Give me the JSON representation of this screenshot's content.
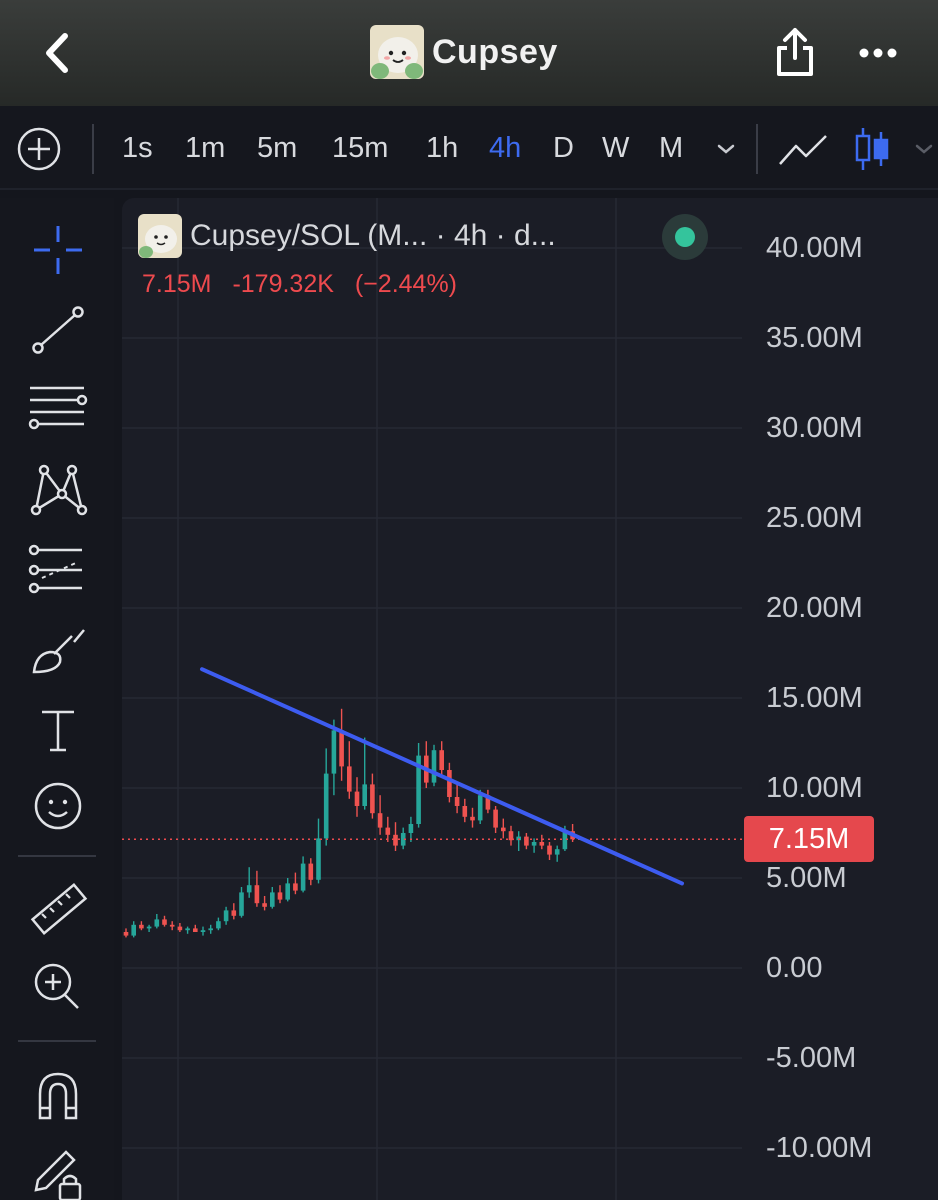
{
  "header": {
    "title": "Cupsey",
    "back_icon": "chevron-left-icon",
    "share_icon": "share-icon",
    "more_icon": "more-horizontal-icon"
  },
  "timeframes": {
    "items": [
      "1s",
      "1m",
      "5m",
      "15m",
      "1h",
      "4h",
      "D",
      "W",
      "M"
    ],
    "active": "4h"
  },
  "chart": {
    "legend_title": "Cupsey/SOL (M... · 4h · d...",
    "last_value": "7.15M",
    "change": "-179.32K",
    "change_pct": "(−2.44%)",
    "price_tag": "7.15M",
    "y_ticks": [
      "40.00M",
      "35.00M",
      "30.00M",
      "25.00M",
      "20.00M",
      "15.00M",
      "10.00M",
      "5.00M",
      "0.00",
      "-5.00M",
      "-10.00M"
    ],
    "up_color": "#26a69a",
    "down_color": "#ef5350",
    "trendline_color": "#3d5cf0"
  },
  "chart_data": {
    "type": "candlestick",
    "interval": "4h",
    "ylim": [
      -12000000,
      42000000
    ],
    "last": 7150000,
    "trendline": {
      "from": 16600000,
      "to": 4700000
    },
    "ohlc": [
      [
        2.0,
        2.2,
        1.7,
        1.8
      ],
      [
        1.8,
        2.6,
        1.7,
        2.4
      ],
      [
        2.4,
        2.6,
        2.1,
        2.2
      ],
      [
        2.2,
        2.4,
        2.0,
        2.3
      ],
      [
        2.3,
        3.0,
        2.2,
        2.7
      ],
      [
        2.7,
        2.9,
        2.3,
        2.4
      ],
      [
        2.4,
        2.6,
        2.1,
        2.3
      ],
      [
        2.3,
        2.5,
        2.0,
        2.1
      ],
      [
        2.1,
        2.3,
        1.9,
        2.2
      ],
      [
        2.2,
        2.4,
        2.0,
        2.0
      ],
      [
        2.0,
        2.3,
        1.8,
        2.1
      ],
      [
        2.1,
        2.4,
        1.9,
        2.2
      ],
      [
        2.2,
        2.8,
        2.1,
        2.6
      ],
      [
        2.6,
        3.4,
        2.4,
        3.2
      ],
      [
        3.2,
        3.6,
        2.7,
        2.9
      ],
      [
        2.9,
        4.5,
        2.8,
        4.2
      ],
      [
        4.2,
        5.6,
        3.9,
        4.6
      ],
      [
        4.6,
        5.4,
        3.4,
        3.6
      ],
      [
        3.6,
        4.0,
        3.2,
        3.4
      ],
      [
        3.4,
        4.5,
        3.3,
        4.2
      ],
      [
        4.2,
        4.6,
        3.6,
        3.8
      ],
      [
        3.8,
        5.0,
        3.7,
        4.7
      ],
      [
        4.7,
        5.3,
        4.1,
        4.3
      ],
      [
        4.3,
        6.2,
        4.2,
        5.8
      ],
      [
        5.8,
        6.1,
        4.6,
        4.9
      ],
      [
        4.9,
        8.3,
        4.7,
        7.2
      ],
      [
        7.2,
        12.2,
        6.8,
        10.8
      ],
      [
        10.8,
        13.8,
        9.6,
        13.2
      ],
      [
        13.2,
        14.4,
        10.4,
        11.2
      ],
      [
        11.2,
        12.6,
        9.4,
        9.8
      ],
      [
        9.8,
        10.6,
        8.4,
        9.0
      ],
      [
        9.0,
        12.8,
        8.8,
        10.2
      ],
      [
        10.2,
        10.8,
        8.3,
        8.6
      ],
      [
        8.6,
        9.6,
        7.4,
        7.8
      ],
      [
        7.8,
        8.4,
        7.0,
        7.4
      ],
      [
        7.4,
        8.1,
        6.5,
        6.8
      ],
      [
        6.8,
        7.8,
        6.6,
        7.5
      ],
      [
        7.5,
        8.4,
        7.0,
        8.0
      ],
      [
        8.0,
        12.5,
        7.8,
        11.8
      ],
      [
        11.8,
        12.6,
        10.0,
        10.3
      ],
      [
        10.3,
        12.4,
        10.1,
        12.1
      ],
      [
        12.1,
        12.6,
        10.6,
        11.0
      ],
      [
        11.0,
        11.4,
        9.2,
        9.5
      ],
      [
        9.5,
        10.2,
        8.6,
        9.0
      ],
      [
        9.0,
        9.4,
        8.1,
        8.4
      ],
      [
        8.4,
        8.9,
        7.8,
        8.2
      ],
      [
        8.2,
        9.9,
        8.0,
        9.6
      ],
      [
        9.6,
        9.9,
        8.6,
        8.8
      ],
      [
        8.8,
        9.0,
        7.5,
        7.8
      ],
      [
        7.8,
        8.3,
        7.2,
        7.6
      ],
      [
        7.6,
        7.9,
        6.8,
        7.1
      ],
      [
        7.1,
        7.6,
        6.5,
        7.3
      ],
      [
        7.3,
        7.5,
        6.6,
        6.8
      ],
      [
        6.8,
        7.2,
        6.4,
        7.0
      ],
      [
        7.0,
        7.4,
        6.6,
        6.8
      ],
      [
        6.8,
        7.0,
        6.0,
        6.3
      ],
      [
        6.3,
        6.8,
        5.9,
        6.6
      ],
      [
        6.6,
        7.9,
        6.5,
        7.6
      ],
      [
        7.6,
        8.0,
        7.0,
        7.15
      ]
    ]
  }
}
